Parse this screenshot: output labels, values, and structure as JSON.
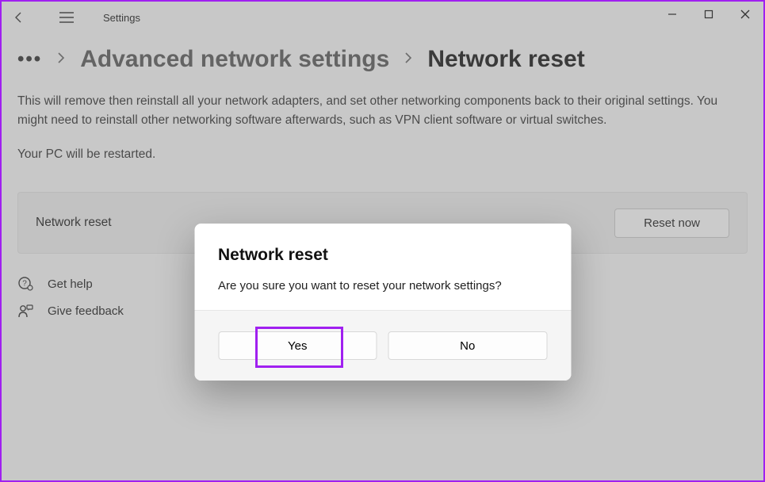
{
  "titlebar": {
    "app_name": "Settings"
  },
  "breadcrumb": {
    "parent": "Advanced network settings",
    "current": "Network reset"
  },
  "page": {
    "description": "This will remove then reinstall all your network adapters, and set other networking components back to their original settings. You might need to reinstall other networking software afterwards, such as VPN client software or virtual switches.",
    "restart_note": "Your PC will be restarted."
  },
  "card": {
    "label": "Network reset",
    "button": "Reset now"
  },
  "links": {
    "help": "Get help",
    "feedback": "Give feedback"
  },
  "dialog": {
    "title": "Network reset",
    "message": "Are you sure you want to reset your network settings?",
    "yes": "Yes",
    "no": "No"
  },
  "colors": {
    "highlight": "#a020f0"
  }
}
